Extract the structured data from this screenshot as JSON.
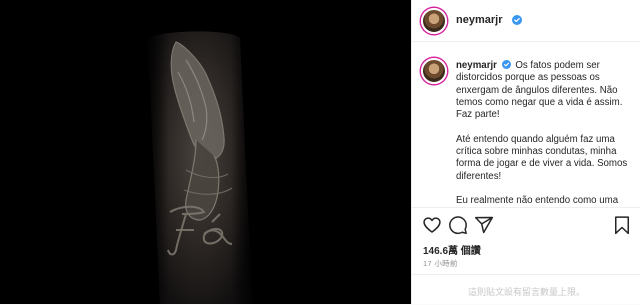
{
  "post": {
    "username": "neymarjr",
    "image": {
      "subject": "praying hands tattoo on forearm",
      "tattoo_text": "Fé"
    },
    "caption": {
      "username": "neymarjr",
      "paragraph_1": "Os fatos podem ser distorcidos porque as pessoas os enxergam de ângulos diferentes. Não temos como negar que a vida é assim. Faz parte!",
      "paragraph_2": "Até entendo quando alguém faz uma crítica sobre minhas condutas, minha forma de jogar e de viver a vida. Somos diferentes!",
      "paragraph_3": "Eu realmente não entendo como uma"
    },
    "likes": "146.6萬 個讚",
    "time": "17 小時前",
    "comments_disabled": "這則貼文設有留言數量上限。"
  },
  "icons": {
    "verified": "verified-badge-icon",
    "like": "heart-icon",
    "comment": "comment-icon",
    "share": "share-icon",
    "save": "bookmark-icon"
  },
  "colors": {
    "verified": "#3897f0",
    "text": "#262626",
    "muted": "#8e8e8e",
    "placeholder": "#c7c7c7"
  }
}
